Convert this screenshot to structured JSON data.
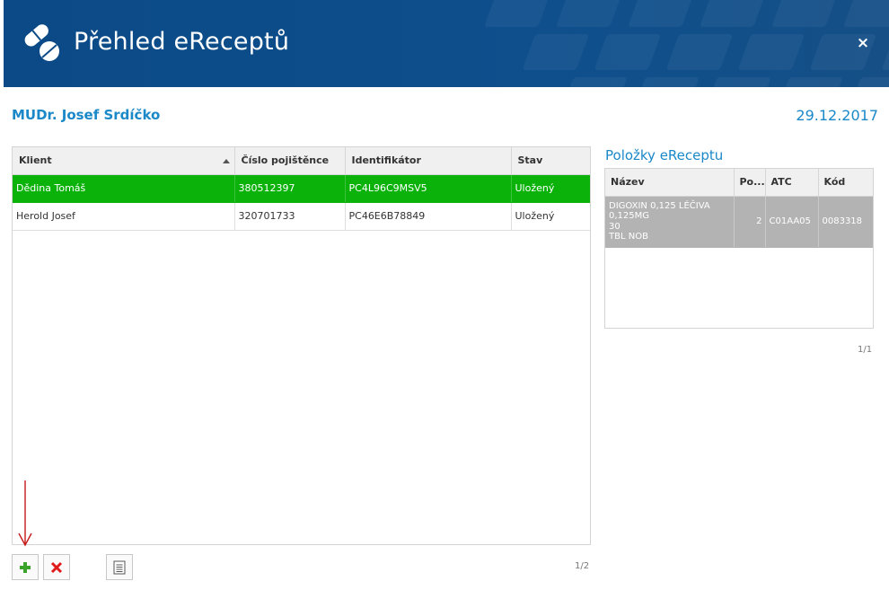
{
  "header": {
    "title": "Přehled eReceptů",
    "close_label": "×"
  },
  "doctor_name": "MUDr. Josef Srdíčko",
  "date": "29.12.2017",
  "left_table": {
    "columns": [
      "Klient",
      "Číslo pojištěnce",
      "Identifikátor",
      "Stav"
    ],
    "rows": [
      [
        "Dědina Tomáš",
        "380512397",
        "PC4L96C9MSV5",
        "Uložený"
      ],
      [
        "Herold Josef",
        "320701733",
        "PC46E6B78849",
        "Uložený"
      ]
    ],
    "pager": "1/2"
  },
  "right_panel": {
    "title": "Položky eReceptu",
    "columns": [
      "Název",
      "Po...",
      "ATC",
      "Kód"
    ],
    "rows": [
      [
        "DIGOXIN 0,125 LÉČIVA\n0,125MG\n30\nTBL NOB",
        "2",
        "C01AA05",
        "0083318"
      ]
    ],
    "pager": "1/1"
  },
  "toolbar": {
    "add_icon": "plus-icon",
    "delete_icon": "x-icon",
    "detail_icon": "document-icon"
  },
  "colors": {
    "header_bg": "#0d4c88",
    "accent": "#1b88c8",
    "selected_row": "#0ab20a",
    "gray_row": "#b3b3b3",
    "delete_red": "#e01b1b",
    "add_green": "#3aa42a"
  }
}
